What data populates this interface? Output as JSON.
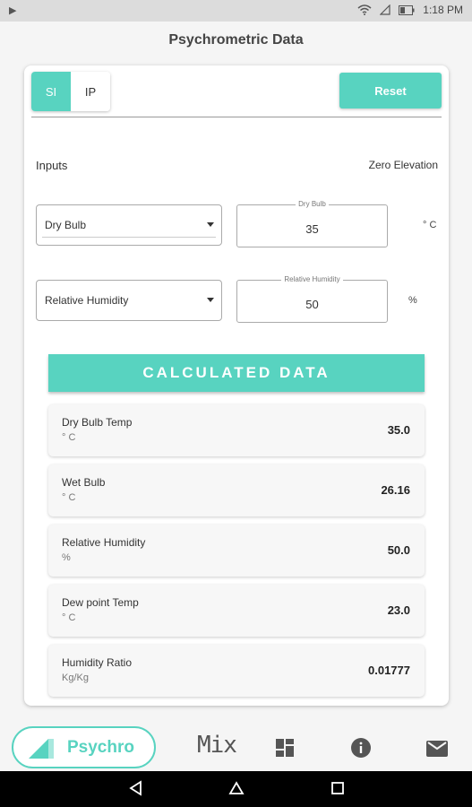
{
  "status_bar": {
    "time": "1:18 PM"
  },
  "header": {
    "title": "Psychrometric Data"
  },
  "units_toggle": {
    "si_label": "SI",
    "ip_label": "IP",
    "selected": "SI"
  },
  "reset_label": "Reset",
  "inputs_section": {
    "label": "Inputs",
    "elevation_label": "Zero Elevation",
    "input1": {
      "select_value": "Dry Bulb",
      "field_label": "Dry Bulb",
      "value": "35",
      "unit": "° C"
    },
    "input2": {
      "select_value": "Relative Humidity",
      "field_label": "Relative Humidity",
      "value": "50",
      "unit": "%"
    }
  },
  "calculated": {
    "title": "CALCULATED DATA",
    "items": [
      {
        "name": "Dry Bulb Temp",
        "unit": "° C",
        "value": "35.0"
      },
      {
        "name": "Wet Bulb",
        "unit": "° C",
        "value": "26.16"
      },
      {
        "name": "Relative Humidity",
        "unit": "%",
        "value": "50.0"
      },
      {
        "name": "Dew point Temp",
        "unit": "° C",
        "value": "23.0"
      },
      {
        "name": "Humidity Ratio",
        "unit": "Kg/Kg",
        "value": "0.01777"
      }
    ]
  },
  "bottom_nav": {
    "active_label": "Psychro",
    "mix_label": "Mix",
    "icons": [
      "psychro-chart-icon",
      "mix-icon",
      "dashboard-icon",
      "info-icon",
      "mail-icon"
    ]
  },
  "colors": {
    "accent": "#58d3c0",
    "background": "#f5f5f5",
    "status_bar": "#dcdcdc"
  }
}
